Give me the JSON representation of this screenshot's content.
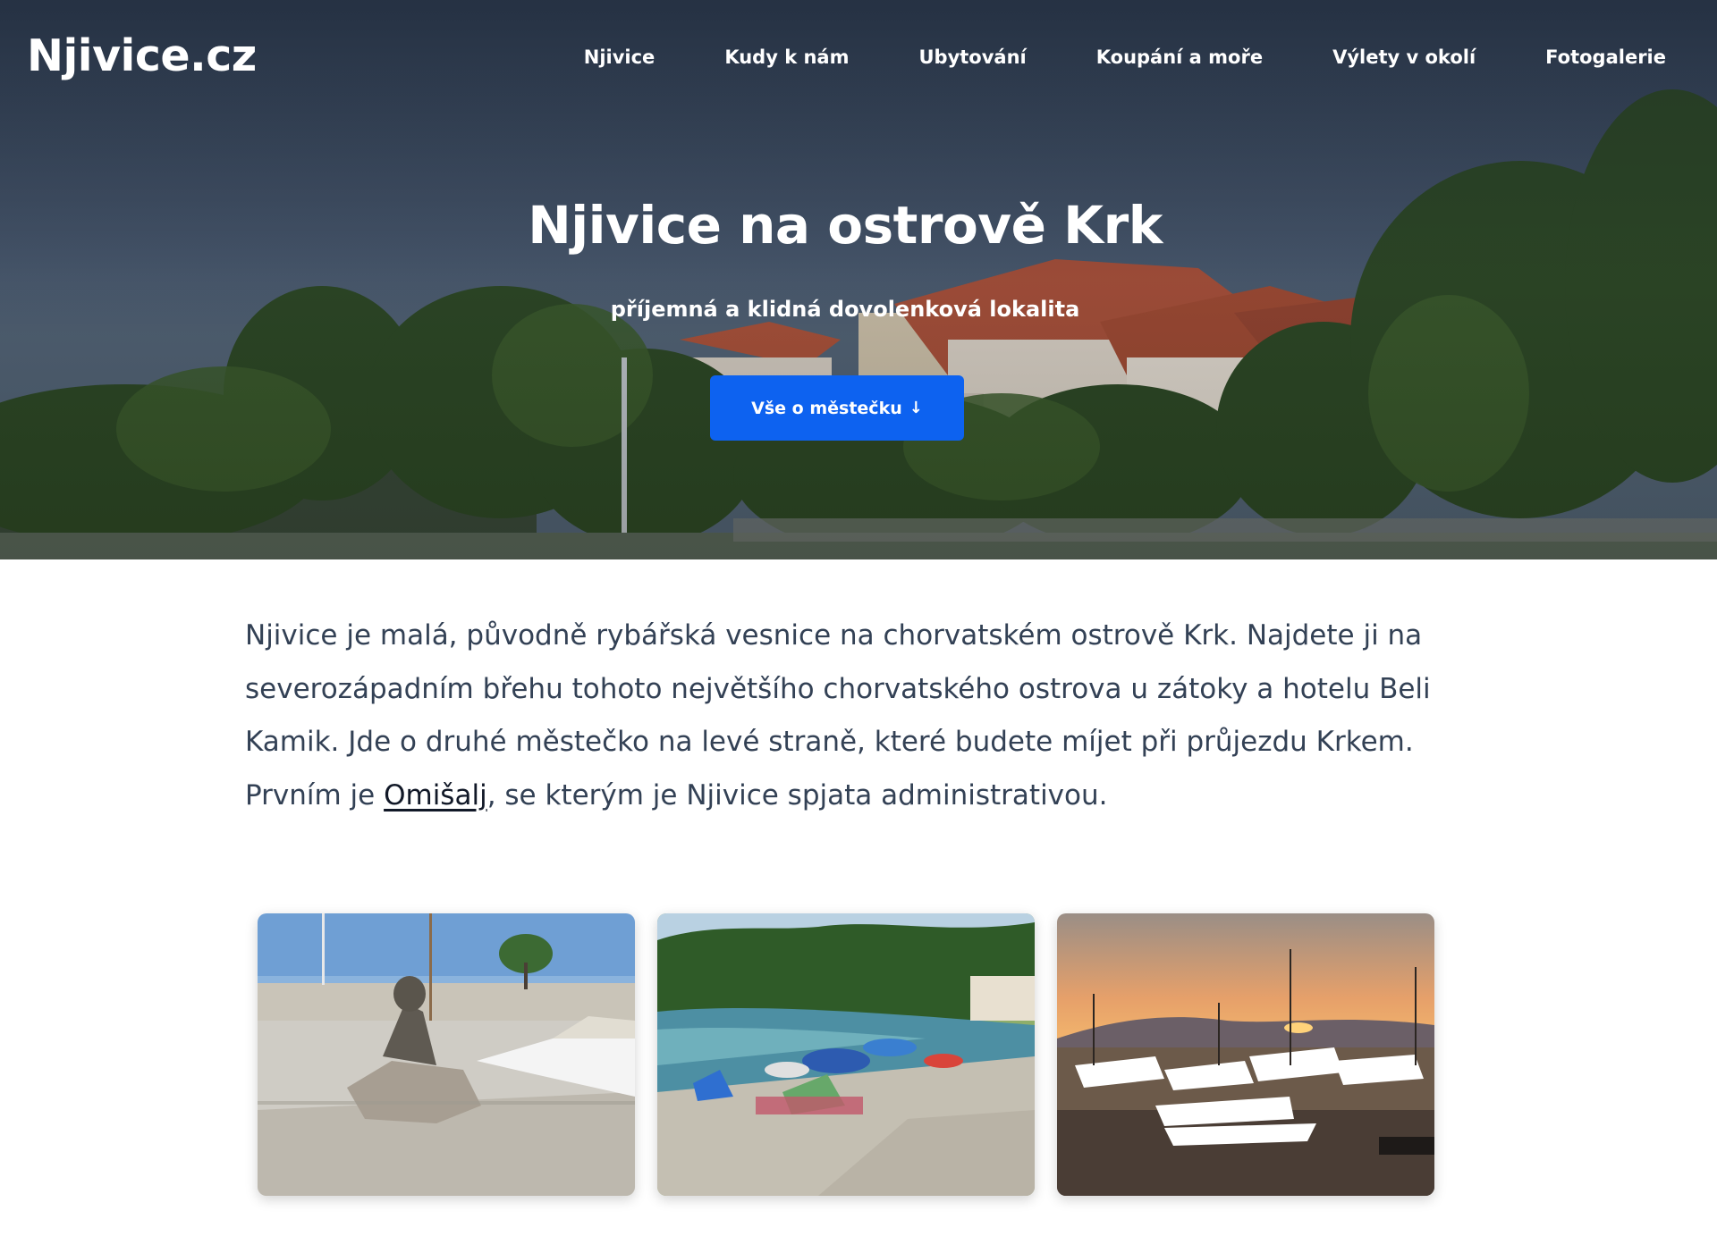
{
  "site": {
    "logo": "Njivice.cz"
  },
  "nav": {
    "items": [
      {
        "label": "Njivice"
      },
      {
        "label": "Kudy k nám"
      },
      {
        "label": "Ubytování"
      },
      {
        "label": "Koupání a moře"
      },
      {
        "label": "Výlety v okolí"
      },
      {
        "label": "Fotogalerie"
      }
    ]
  },
  "hero": {
    "title": "Njivice na ostrově Krk",
    "subtitle": "příjemná a klidná dovolenková lokalita",
    "button_label": "Vše o městečku",
    "button_icon": "arrow-down-icon"
  },
  "intro": {
    "text_before_link": "Njivice je malá, původně rybářská vesnice na chorvatském ostrově Krk. Najdete ji na severozápadním břehu tohoto největšího chorvatského ostrova u zátoky a hotelu Beli Kamik. Jde o druhé městečko na levé straně, které budete míjet při průjezdu Krkem. Prvním je ",
    "link_label": "Omišalj",
    "text_after_link": ", se kterým je Njivice spjata administrativou."
  },
  "colors": {
    "accent": "#0d62f0",
    "text": "#334155",
    "link": "#111827"
  }
}
